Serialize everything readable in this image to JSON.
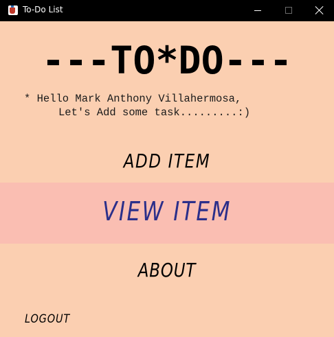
{
  "window": {
    "title": "To-Do List",
    "icon": "java-cup-icon"
  },
  "colors": {
    "background": "#fbcfb1",
    "selected_band": "#fabeb2",
    "selected_text": "#2b2f8a",
    "titlebar": "#000000"
  },
  "header": {
    "title": "---TO*DO---"
  },
  "greeting": {
    "line1": "* Hello Mark Anthony Villahermosa,",
    "line2": "Let's Add some task.........:)"
  },
  "menu": {
    "add_label": "ADD ITEM",
    "view_label": "VIEW ITEM",
    "about_label": "ABOUT",
    "selected": "VIEW ITEM"
  },
  "footer": {
    "logout_label": "LOGOUT"
  }
}
